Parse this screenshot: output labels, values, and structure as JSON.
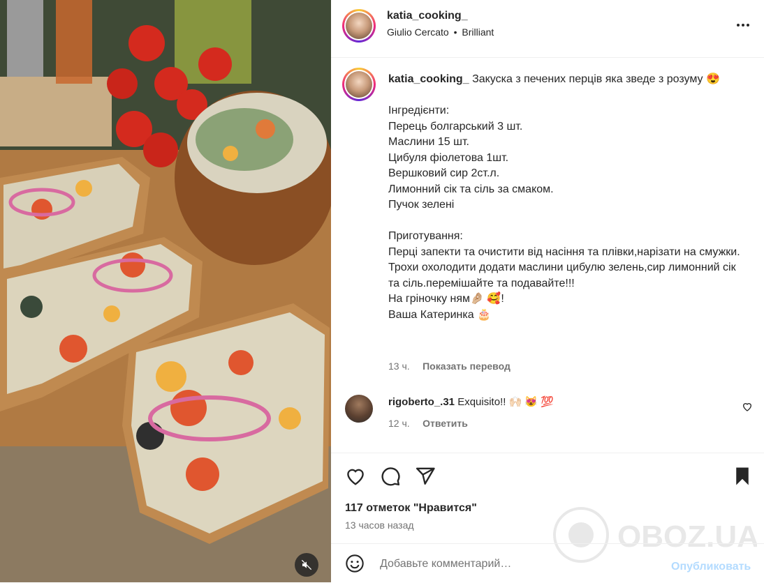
{
  "post": {
    "author": "katia_cooking_",
    "audio": "Giulio Cercato",
    "separator": "•",
    "audio_title": "Brilliant"
  },
  "caption": {
    "author": "katia_cooking_",
    "text": "Закуска з печених перців яка зведе з розуму 😍\n\nІнгредієнти:\nПерець болгарський 3 шт.\nМаслини 15 шт.\nЦибуля фіолетова 1шт.\nВершковий сир 2ст.л.\nЛимонний сік та сіль за смаком.\nПучок зелені\n\nПриготування:\nПерці запекти та очистити від насіння та плівки,нарізати на смужки.\nТрохи охолодити додати маслини цибулю зелень,сир лимонний сік та сіль.перемішайте та подавайте!!!\nНа гріночку ням🤌🏼 🥰!\nВаша Катеринка 🎂",
    "time": "13 ч.",
    "translate": "Показать перевод"
  },
  "comment": {
    "author": "rigoberto_.31",
    "text": "Exquisito!! 🙌🏻 😻 💯",
    "time": "12 ч.",
    "reply": "Ответить"
  },
  "actions": {
    "likes": "117 отметок \"Нравится\"",
    "time_ago": "13 часов назад"
  },
  "add_comment": {
    "placeholder": "Добавьте комментарий…",
    "post_label": "Опубликовать"
  },
  "watermark": {
    "text": "OBOZ.UA"
  },
  "icons": {
    "more": "more-dots-icon",
    "heart": "heart-icon",
    "comment": "comment-icon",
    "share": "share-icon",
    "save": "bookmark-icon",
    "emoji": "emoji-icon",
    "mute": "muted-audio-icon"
  },
  "colors": {
    "accent_disabled": "#b3dbff",
    "text": "#262626",
    "muted": "#737373"
  }
}
